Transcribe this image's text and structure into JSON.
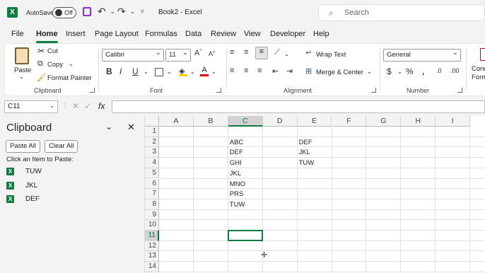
{
  "titlebar": {
    "autosave_label": "AutoSave",
    "toggle_text": "Off",
    "title": "Book2  -  Excel",
    "search_placeholder": "Search"
  },
  "menu": [
    "File",
    "Home",
    "Insert",
    "Page Layout",
    "Formulas",
    "Data",
    "Review",
    "View",
    "Developer",
    "Help"
  ],
  "ribbon": {
    "clipboard": {
      "paste": "Paste",
      "cut": "Cut",
      "copy": "Copy",
      "format_painter": "Format Painter",
      "label": "Clipboard"
    },
    "font": {
      "name": "Calibri",
      "size": "11",
      "label": "Font"
    },
    "alignment": {
      "wrap": "Wrap Text",
      "merge": "Merge & Center",
      "label": "Alignment"
    },
    "number": {
      "format": "General",
      "label": "Number"
    },
    "styles": {
      "cond_1": "Cond",
      "cond_2": "Form"
    }
  },
  "formula": {
    "namebox": "C11",
    "fx": "fx",
    "value": ""
  },
  "clipboard_pane": {
    "title": "Clipboard",
    "paste_all": "Paste All",
    "clear_all": "Clear All",
    "hint": "Click an Item to Paste:",
    "items": [
      "TUW",
      "JKL",
      "DEF"
    ]
  },
  "sheet": {
    "columns": [
      "A",
      "B",
      "C",
      "D",
      "E",
      "F",
      "G",
      "H",
      "I"
    ],
    "rows": [
      "1",
      "2",
      "3",
      "4",
      "5",
      "6",
      "7",
      "8",
      "9",
      "10",
      "11",
      "12",
      "13",
      "14"
    ],
    "col_c": [
      "ABC",
      "DEF",
      "GHI",
      "JKL",
      "MNO",
      "PRS",
      "TUW"
    ],
    "col_e": [
      "DEF",
      "JKL",
      "TUW"
    ],
    "selected_cell": "C11"
  }
}
